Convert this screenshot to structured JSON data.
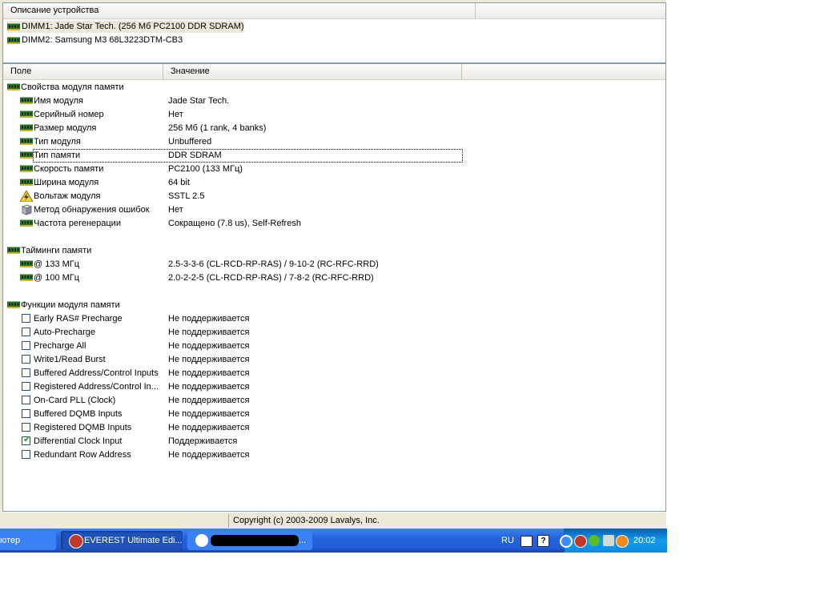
{
  "device_panel": {
    "header": "Описание устройства",
    "items": [
      {
        "label": "DIMM1: Jade Star Tech. (256 Мб PC2100 DDR SDRAM)",
        "icon": "memory-module-icon"
      },
      {
        "label": "DIMM2: Samsung M3 68L3223DTM-CB3",
        "icon": "memory-module-icon"
      }
    ]
  },
  "columns": {
    "field": "Поле",
    "value": "Значение"
  },
  "groups": {
    "module": {
      "title": "Свойства модуля памяти",
      "rows": [
        {
          "field": "Имя модуля",
          "value": "Jade Star Tech."
        },
        {
          "field": "Серийный номер",
          "value": "Нет"
        },
        {
          "field": "Размер модуля",
          "value": "256 Мб (1 rank, 4 banks)"
        },
        {
          "field": "Тип модуля",
          "value": "Unbuffered"
        },
        {
          "field": "Тип памяти",
          "value": "DDR SDRAM"
        },
        {
          "field": "Скорость памяти",
          "value": "PC2100 (133 МГц)"
        },
        {
          "field": "Ширина модуля",
          "value": "64 bit"
        },
        {
          "field": "Вольтаж модуля",
          "value": "SSTL 2.5"
        },
        {
          "field": "Метод обнаружения ошибок",
          "value": "Нет"
        },
        {
          "field": "Частота регенерации",
          "value": "Сокращено (7.8 us), Self-Refresh"
        }
      ]
    },
    "timings": {
      "title": "Тайминги памяти",
      "rows": [
        {
          "field": "@ 133 МГц",
          "value": "2.5-3-3-6  (CL-RCD-RP-RAS) / 9-10-2  (RC-RFC-RRD)"
        },
        {
          "field": "@ 100 МГц",
          "value": "2.0-2-2-5  (CL-RCD-RP-RAS) / 7-8-2  (RC-RFC-RRD)"
        }
      ]
    },
    "features": {
      "title": "Функции модуля памяти",
      "rows": [
        {
          "field": "Early RAS# Precharge",
          "value": "Не поддерживается",
          "checked": false
        },
        {
          "field": "Auto-Precharge",
          "value": "Не поддерживается",
          "checked": false
        },
        {
          "field": "Precharge All",
          "value": "Не поддерживается",
          "checked": false
        },
        {
          "field": "Write1/Read Burst",
          "value": "Не поддерживается",
          "checked": false
        },
        {
          "field": "Buffered Address/Control Inputs",
          "value": "Не поддерживается",
          "checked": false
        },
        {
          "field": "Registered Address/Control In...",
          "value": "Не поддерживается",
          "checked": false
        },
        {
          "field": "On-Card PLL (Clock)",
          "value": "Не поддерживается",
          "checked": false
        },
        {
          "field": "Buffered DQMB Inputs",
          "value": "Не поддерживается",
          "checked": false
        },
        {
          "field": "Registered DQMB Inputs",
          "value": "Не поддерживается",
          "checked": false
        },
        {
          "field": "Differential Clock Input",
          "value": "Поддерживается",
          "checked": true
        },
        {
          "field": "Redundant Row Address",
          "value": "Не поддерживается",
          "checked": false
        }
      ]
    }
  },
  "status_bar": {
    "copyright": "Copyright (c) 2003-2009 Lavalys, Inc."
  },
  "taskbar": {
    "left_partial": "ютер",
    "buttons": [
      {
        "label": "EVEREST Ultimate Edi...",
        "icon": "everest-info-icon",
        "active": true
      },
      {
        "label": "...",
        "icon": "chat-icon",
        "active": false
      }
    ],
    "language": "RU",
    "clock": "20:02"
  },
  "colors": {
    "accent": "#245edb",
    "tray": "#0f8ae0",
    "selection": "#ece9d8",
    "checkmark": "#21a121"
  }
}
